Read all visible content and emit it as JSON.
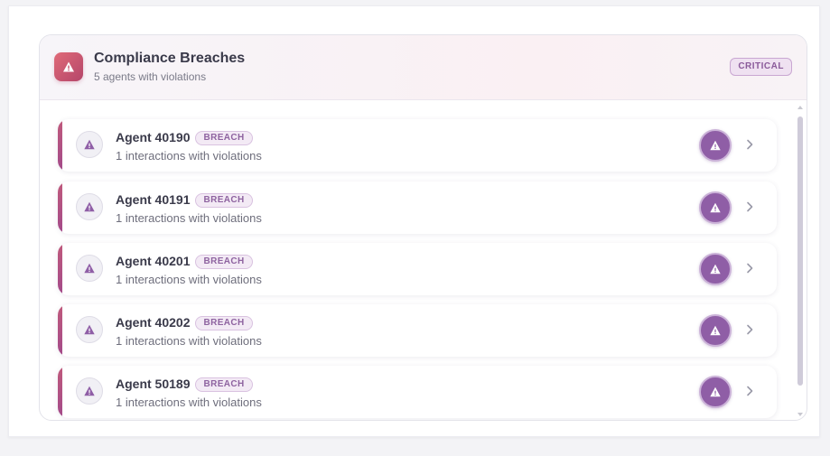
{
  "panel": {
    "title": "Compliance Breaches",
    "subtitle": "5 agents with violations",
    "severity_badge": "CRITICAL",
    "header_icon": "warning-triangle-icon"
  },
  "agents": [
    {
      "name": "Agent 40190",
      "badge": "BREACH",
      "detail": "1 interactions with violations"
    },
    {
      "name": "Agent 40191",
      "badge": "BREACH",
      "detail": "1 interactions with violations"
    },
    {
      "name": "Agent 40201",
      "badge": "BREACH",
      "detail": "1 interactions with violations"
    },
    {
      "name": "Agent 40202",
      "badge": "BREACH",
      "detail": "1 interactions with violations"
    },
    {
      "name": "Agent 50189",
      "badge": "BREACH",
      "detail": "1 interactions with violations"
    }
  ],
  "icons": {
    "row_icon": "warning-triangle-icon",
    "action_icon": "warning-triangle-icon",
    "chevron": "chevron-right-icon"
  },
  "colors": {
    "accent": "#8f5ea6",
    "header_icon_bg": "#c9566e",
    "row_accent": "#b4527f",
    "badge_text": "#8e63a0"
  }
}
